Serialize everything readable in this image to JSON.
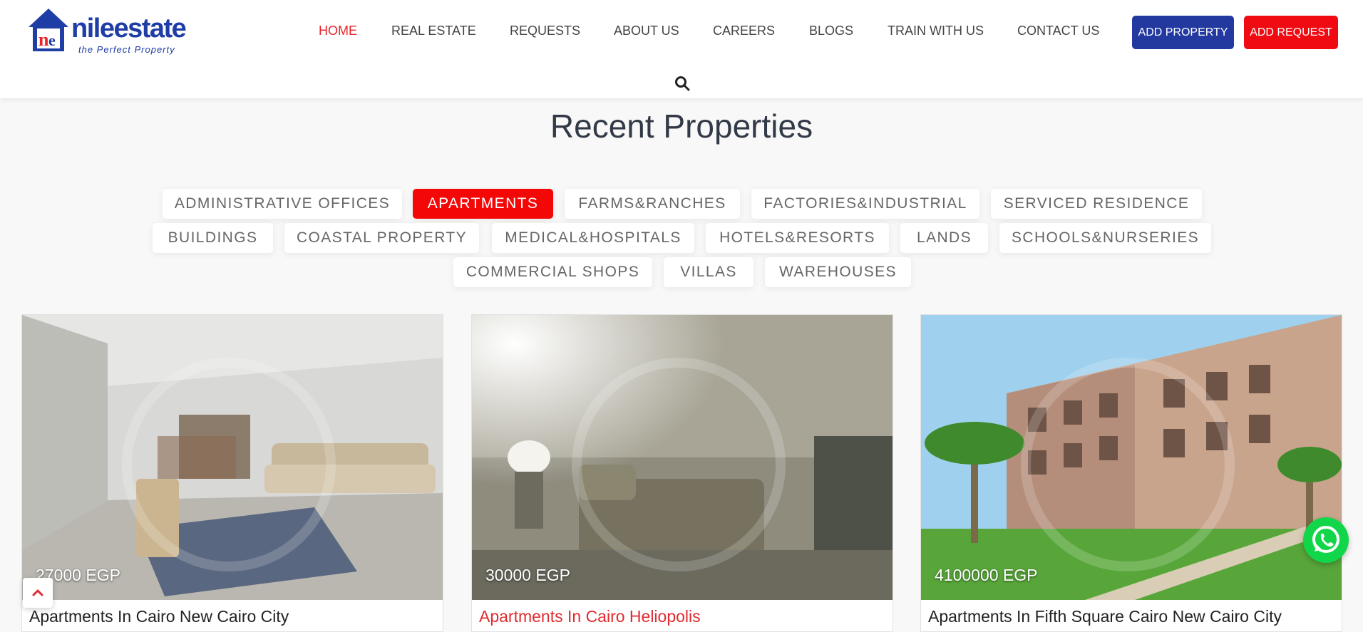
{
  "brand": {
    "name": "nileestate",
    "tagline": "the Perfect Property"
  },
  "nav": {
    "items": [
      {
        "label": "HOME",
        "active": true
      },
      {
        "label": "REAL ESTATE"
      },
      {
        "label": "REQUESTS"
      },
      {
        "label": "ABOUT US"
      },
      {
        "label": "CAREERS"
      },
      {
        "label": "BLOGS"
      },
      {
        "label": "TRAIN WITH US"
      },
      {
        "label": "CONTACT US"
      }
    ],
    "add_property": "ADD PROPERTY",
    "add_request": "ADD REQUEST"
  },
  "section": {
    "title": "Recent Properties"
  },
  "filters": [
    {
      "label": "ADMINISTRATIVE OFFICES"
    },
    {
      "label": "APARTMENTS",
      "active": true
    },
    {
      "label": "FARMS&RANCHES"
    },
    {
      "label": "FACTORIES&INDUSTRIAL"
    },
    {
      "label": "SERVICED RESIDENCE"
    },
    {
      "label": "BUILDINGS"
    },
    {
      "label": "COASTAL PROPERTY"
    },
    {
      "label": "MEDICAL&HOSPITALS"
    },
    {
      "label": "HOTELS&RESORTS"
    },
    {
      "label": "LANDS"
    },
    {
      "label": "SCHOOLS&NURSERIES"
    },
    {
      "label": "COMMERCIAL SHOPS"
    },
    {
      "label": "VILLAS"
    },
    {
      "label": "WAREHOUSES"
    }
  ],
  "properties": [
    {
      "price": "27000 EGP",
      "title": "Apartments In Cairo New Cairo City"
    },
    {
      "price": "30000 EGP",
      "title": "Apartments In Cairo Heliopolis"
    },
    {
      "price": "4100000 EGP",
      "title": "Apartments In Fifth Square Cairo New Cairo City"
    }
  ],
  "colors": {
    "brand_blue": "#1e3da5",
    "brand_red": "#e8232a",
    "active_filter": "#f40707",
    "whatsapp": "#12d64a"
  },
  "icons": {
    "search": "search-icon",
    "whatsapp": "whatsapp-icon",
    "scroll_top": "chevron-up-icon"
  }
}
